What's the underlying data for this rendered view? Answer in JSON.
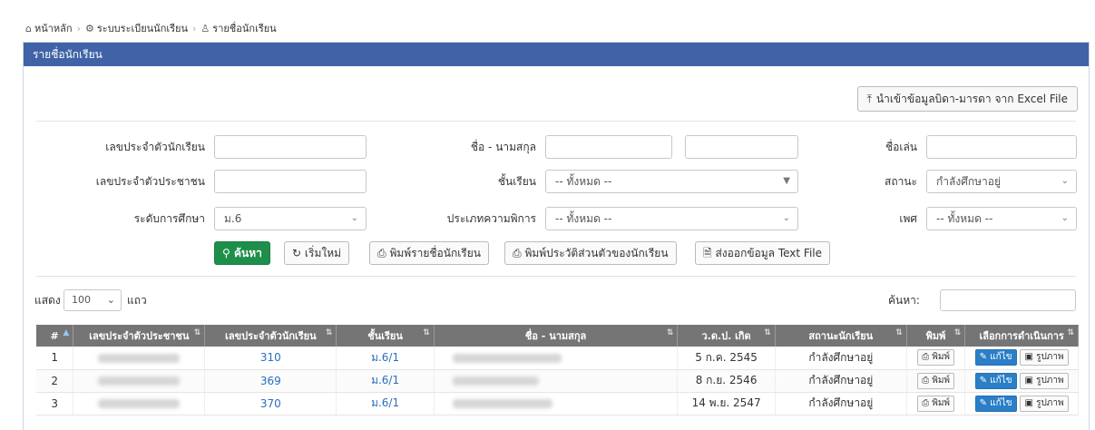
{
  "breadcrumb": {
    "home": "หน้าหลัก",
    "section": "ระบบระเบียนนักเรียน",
    "current": "รายชื่อนักเรียน"
  },
  "panel_title": "รายชื่อนักเรียน",
  "import_button": "นำเข้าข้อมูลบิดา-มารดา จาก Excel File",
  "filters": {
    "student_id_label": "เลขประจำตัวนักเรียน",
    "name_label": "ชื่อ - นามสกุล",
    "nickname_label": "ชื่อเล่น",
    "citizen_id_label": "เลขประจำตัวประชาชน",
    "class_label": "ชั้นเรียน",
    "class_value": "-- ทั้งหมด --",
    "status_label": "สถานะ",
    "status_value": "กำลังศึกษาอยู่",
    "level_label": "ระดับการศึกษา",
    "level_value": "ม.6",
    "disability_label": "ประเภทความพิการ",
    "disability_value": "-- ทั้งหมด --",
    "gender_label": "เพศ",
    "gender_value": "-- ทั้งหมด --"
  },
  "actions": {
    "search": "ค้นหา",
    "reset": "เริ่มใหม่",
    "print_list": "พิมพ์รายชื่อนักเรียน",
    "print_profile": "พิมพ์ประวัติส่วนตัวของนักเรียน",
    "export_text": "ส่งออกข้อมูล Text File"
  },
  "table_controls": {
    "show_label": "แสดง",
    "page_size": "100",
    "rows_label": "แถว",
    "search_label": "ค้นหา:"
  },
  "table": {
    "headers": [
      "#",
      "เลขประจำตัวประชาชน",
      "เลขประจำตัวนักเรียน",
      "ชั้นเรียน",
      "ชื่อ - นามสกุล",
      "ว.ด.ป. เกิด",
      "สถานะนักเรียน",
      "พิมพ์",
      "เลือกการดำเนินการ"
    ],
    "rows": [
      {
        "no": "1",
        "student_id": "310",
        "class": "ม.6/1",
        "dob": "5 ก.ค. 2545",
        "status": "กำลังศึกษาอยู่"
      },
      {
        "no": "2",
        "student_id": "369",
        "class": "ม.6/1",
        "dob": "8 ก.ย. 2546",
        "status": "กำลังศึกษาอยู่"
      },
      {
        "no": "3",
        "student_id": "370",
        "class": "ม.6/1",
        "dob": "14 พ.ย. 2547",
        "status": "กำลังศึกษาอยู่"
      }
    ],
    "print_btn": "พิมพ์",
    "edit_btn": "แก้ไข",
    "photo_btn": "รูปภาพ"
  },
  "colors": {
    "header_blue": "#3f63a6",
    "search_green": "#1e8f4b",
    "table_header": "#757575",
    "link": "#2a6ebb"
  }
}
